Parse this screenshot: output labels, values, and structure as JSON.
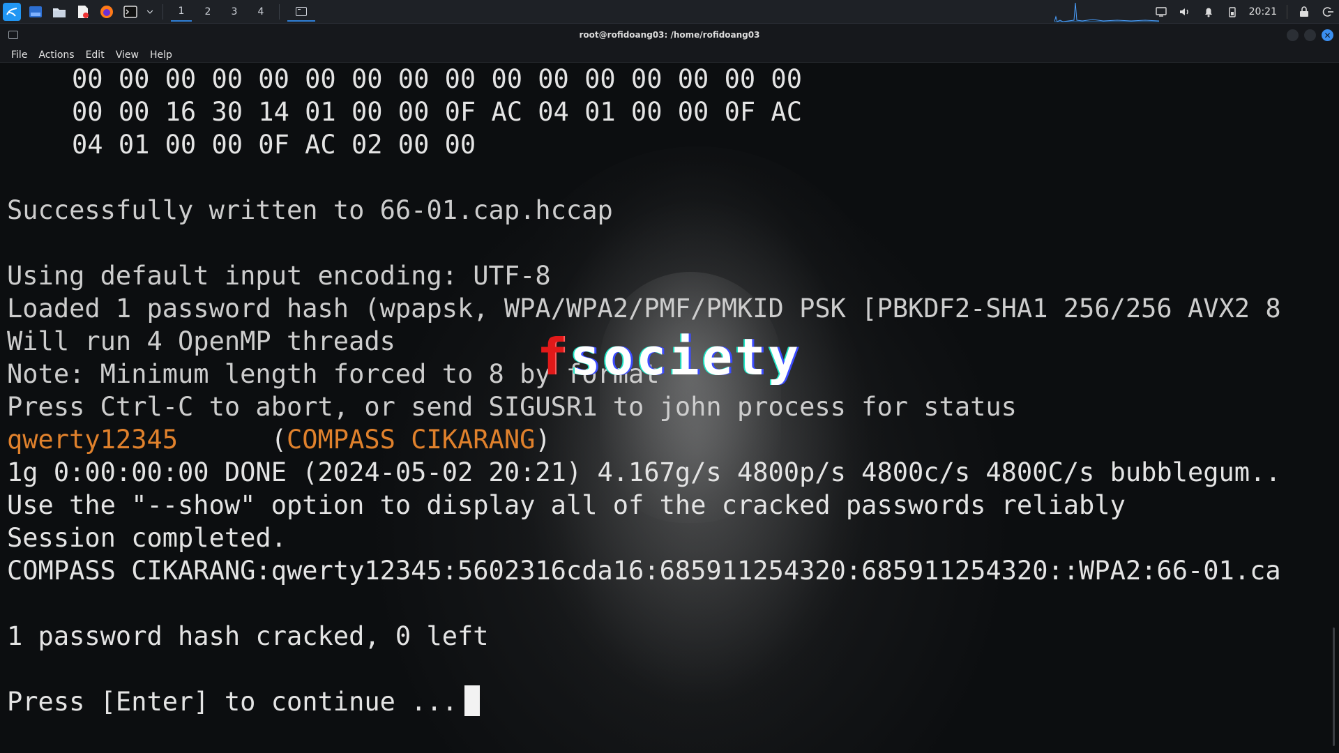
{
  "panel": {
    "workspaces": [
      "1",
      "2",
      "3",
      "4"
    ],
    "active_workspace": "1",
    "clock": "20:21",
    "icons": [
      "kali-menu-icon",
      "workspace-window-icon",
      "file-manager-icon",
      "text-editor-icon",
      "firefox-icon",
      "terminal-icon",
      "terminal-dropdown-icon",
      "terminal-task-icon",
      "network-icon",
      "volume-icon",
      "notification-bell-icon",
      "power-battery-icon",
      "lock-icon",
      "logout-icon"
    ]
  },
  "window": {
    "title": "root@rofidoang03: /home/rofidoang03"
  },
  "menu": [
    "File",
    "Actions",
    "Edit",
    "View",
    "Help"
  ],
  "terminal": {
    "hex_lines": [
      "00 00 00 00 00 00 00 00 00 00 00 00 00 00 00 00",
      "00 00 16 30 14 01 00 00 0F AC 04 01 00 00 0F AC",
      "04 01 00 00 0F AC 02 00 00"
    ],
    "written": "Successfully written to 66-01.cap.hccap",
    "encoding": "Using default input encoding: UTF-8",
    "loaded": "Loaded 1 password hash (wpapsk, WPA/WPA2/PMF/PMKID PSK [PBKDF2-SHA1 256/256 AVX2 8",
    "threads": "Will run 4 OpenMP threads",
    "note": "Note: Minimum length forced to 8 by format",
    "press_ctrl": "Press Ctrl-C to abort, or send SIGUSR1 to john process for status",
    "cracked_password": "qwerty12345",
    "cracked_essid_open": "      (",
    "cracked_essid": "COMPASS CIKARANG",
    "cracked_essid_close": ")",
    "status": "1g 0:00:00:00 DONE (2024-05-02 20:21) 4.167g/s 4800p/s 4800c/s 4800C/s bubblegum..",
    "show_hint": "Use the \"--show\" option to display all of the cracked passwords reliably",
    "session": "Session completed.",
    "show_line": "COMPASS CIKARANG:qwerty12345:5602316cda16:685911254320:685911254320::WPA2:66-01.ca",
    "summary": "1 password hash cracked, 0 left",
    "continue": "Press [Enter] to continue ..."
  },
  "wallpaper": {
    "logo_f": "f",
    "logo_rest": "society"
  }
}
